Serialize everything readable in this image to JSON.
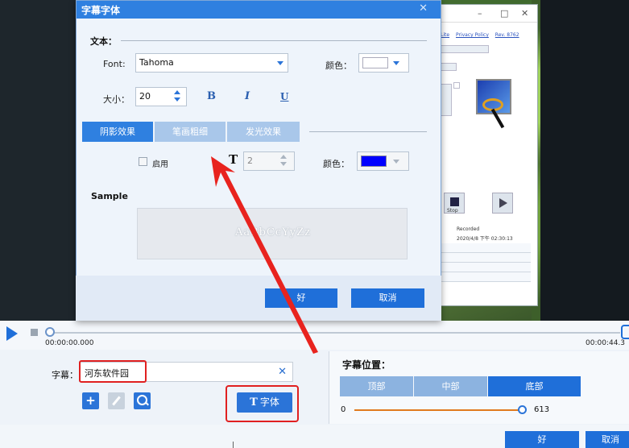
{
  "dialog": {
    "title": "字幕字体",
    "close_glyph": "✕",
    "text_section": "文本：",
    "font_label": "Font:",
    "font_value": "Tahoma",
    "color_label": "颜色：",
    "color_value": "#ffffff",
    "size_label": "大小：",
    "size_value": "20",
    "bold_label": "B",
    "italic_label": "I",
    "underline_label": "U",
    "tabs": [
      "阴影效果",
      "笔画粗细",
      "发光效果"
    ],
    "enable_label": "启用",
    "effect_size_value": "2",
    "effect_color_label": "颜色：",
    "effect_color_value": "#0000ff",
    "sample_label": "Sample",
    "sample_text": "AaBbCcYyZz",
    "ok_label": "好",
    "cancel_label": "取消"
  },
  "player": {
    "time_start": "00:00:00.000",
    "time_end": "00:00:44.3"
  },
  "subtitle": {
    "label": "字幕：",
    "value": "河东软件园",
    "clear_glyph": "✕"
  },
  "toolbar": {
    "add_glyph": "+",
    "font_button": "字体",
    "font_button_icon": "T"
  },
  "position": {
    "label": "字幕位置：",
    "options": [
      "顶部",
      "中部",
      "底部"
    ],
    "selected": "底部",
    "slider_min": "0",
    "slider_value": "613"
  },
  "main_buttons": {
    "ok": "好",
    "cancel": "取消"
  },
  "background_app": {
    "links": [
      "Lite",
      "Privacy Policy",
      "Rev. 8762"
    ],
    "stop_label": "Stop",
    "recorded_label": "Recorded",
    "recorded_value": "2020/4/8 下午 02:30:13"
  },
  "colors": {
    "accent": "#1f6fd9",
    "title_bar": "#2f80e0",
    "highlight": "#e02020"
  }
}
